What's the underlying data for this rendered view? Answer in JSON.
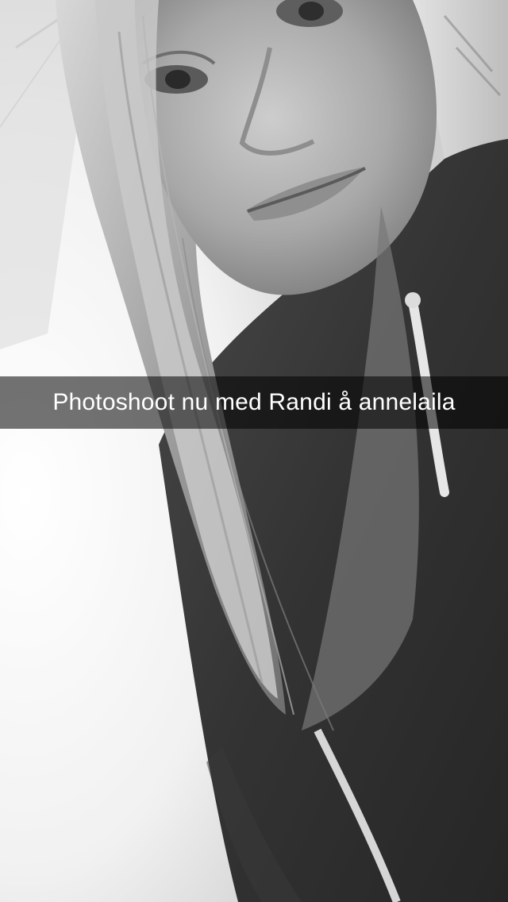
{
  "snap": {
    "caption": "Photoshoot nu med Randi å annelaila",
    "filter": "black-and-white",
    "colors": {
      "caption_bar": "rgba(0,0,0,0.55)",
      "caption_text": "#ffffff"
    }
  }
}
